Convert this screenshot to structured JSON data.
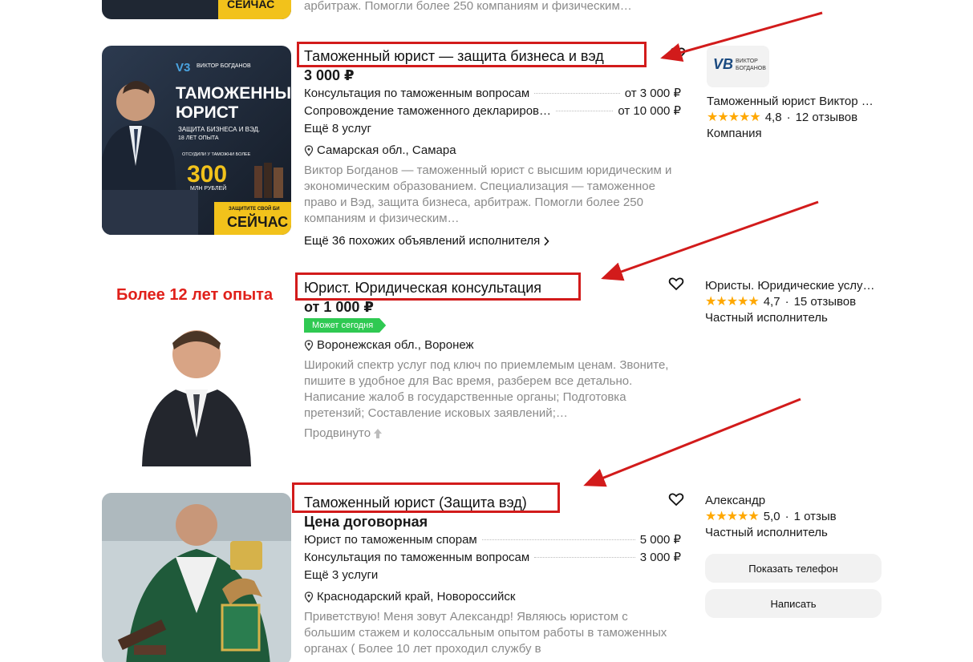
{
  "listings": [
    {
      "desc_tail": "арбитраж. Помогли более 250 компаниям и физическим…",
      "thumb_text": "СЕЙЧАС"
    },
    {
      "title": "Таможенный юрист — защита бизнеса и вэд",
      "price": "3 000 ₽",
      "services": [
        {
          "name": "Консультация по таможенным вопросам",
          "price": "от 3 000 ₽"
        },
        {
          "name": "Сопровождение таможенного деклариров…",
          "price": "от 10 000 ₽"
        }
      ],
      "more_services": "Ещё 8 услуг",
      "location": "Самарская обл., Самара",
      "description": "Виктор Богданов — таможенный юрист с высшим юридическим и экономическим образованием. Специализация — таможенное право и Вэд, защита бизнеса, арбитраж. Помогли более 250 компаниям и физическим…",
      "similar": "Ещё 36 похожих объявлений исполнителя",
      "thumb": {
        "brand": "ВИКТОР БОГДАНОВ",
        "headline1": "ТАМОЖЕННЫ",
        "headline2": "ЮРИСТ",
        "sub1": "ЗАЩИТА БИЗНЕСА И ВЭД.",
        "sub2": "18 ЛЕТ ОПЫТА",
        "stat_label": "ОТСУДИЛИ У ТАМОЖНИ БОЛЕЕ",
        "stat_value": "300",
        "stat_unit": "МЛН РУБЛЕЙ",
        "cta_small": "ЗАЩИТИТЕ СВОЙ БИ",
        "cta": "СЕЙЧАС"
      },
      "seller": {
        "name": "Таможенный юрист Виктор …",
        "rating": "4,8",
        "reviews": "12 отзывов",
        "type": "Компания",
        "logo_letters": "VB",
        "logo_line1": "ВИКТОР",
        "logo_line2": "БОГДАНОВ"
      }
    },
    {
      "title": "Юрист. Юридическая консультация",
      "price": "от 1 000 ₽",
      "badge": "Может сегодня",
      "location": "Воронежская обл., Воронеж",
      "description": "Широкий спектр услуг под ключ по приемлемым ценам. Звоните, пишите в удобное для Вас время, разберем все детально. Написание жалоб в государственные органы; Подготовка претензий; Составление исковых заявлений;…",
      "promoted": "Продвинуто",
      "thumb": {
        "caption": "Более 12 лет опыта"
      },
      "seller": {
        "name": "Юристы. Юридические услу…",
        "rating": "4,7",
        "reviews": "15 отзывов",
        "type": "Частный исполнитель"
      }
    },
    {
      "title": "Таможенный юрист (Защита вэд)",
      "price": "Цена договорная",
      "services": [
        {
          "name": "Юрист по таможенным спорам",
          "price": "5 000 ₽"
        },
        {
          "name": "Консультация по таможенным вопросам",
          "price": "3 000 ₽"
        }
      ],
      "more_services": "Ещё 3 услуги",
      "location": "Краснодарский край, Новороссийск",
      "description": "Приветствую! Меня зовут Александр! Являюсь юристом с большим стажем и колоссальным опытом работы в таможенных органах ( Более 10 лет проходил службу в",
      "seller": {
        "name": "Александр",
        "rating": "5,0",
        "reviews": "1 отзыв",
        "type": "Частный исполнитель"
      },
      "buttons": {
        "phone": "Показать телефон",
        "message": "Написать"
      }
    }
  ],
  "colors": {
    "annotation_red": "#d21b1b",
    "star": "#ffa800",
    "badge_green": "#2fc952",
    "muted_text": "#8a8a8a"
  },
  "icons": [
    "heart-icon",
    "location-pin-icon",
    "chevron-right-icon",
    "arrow-up-icon",
    "star-icon"
  ]
}
